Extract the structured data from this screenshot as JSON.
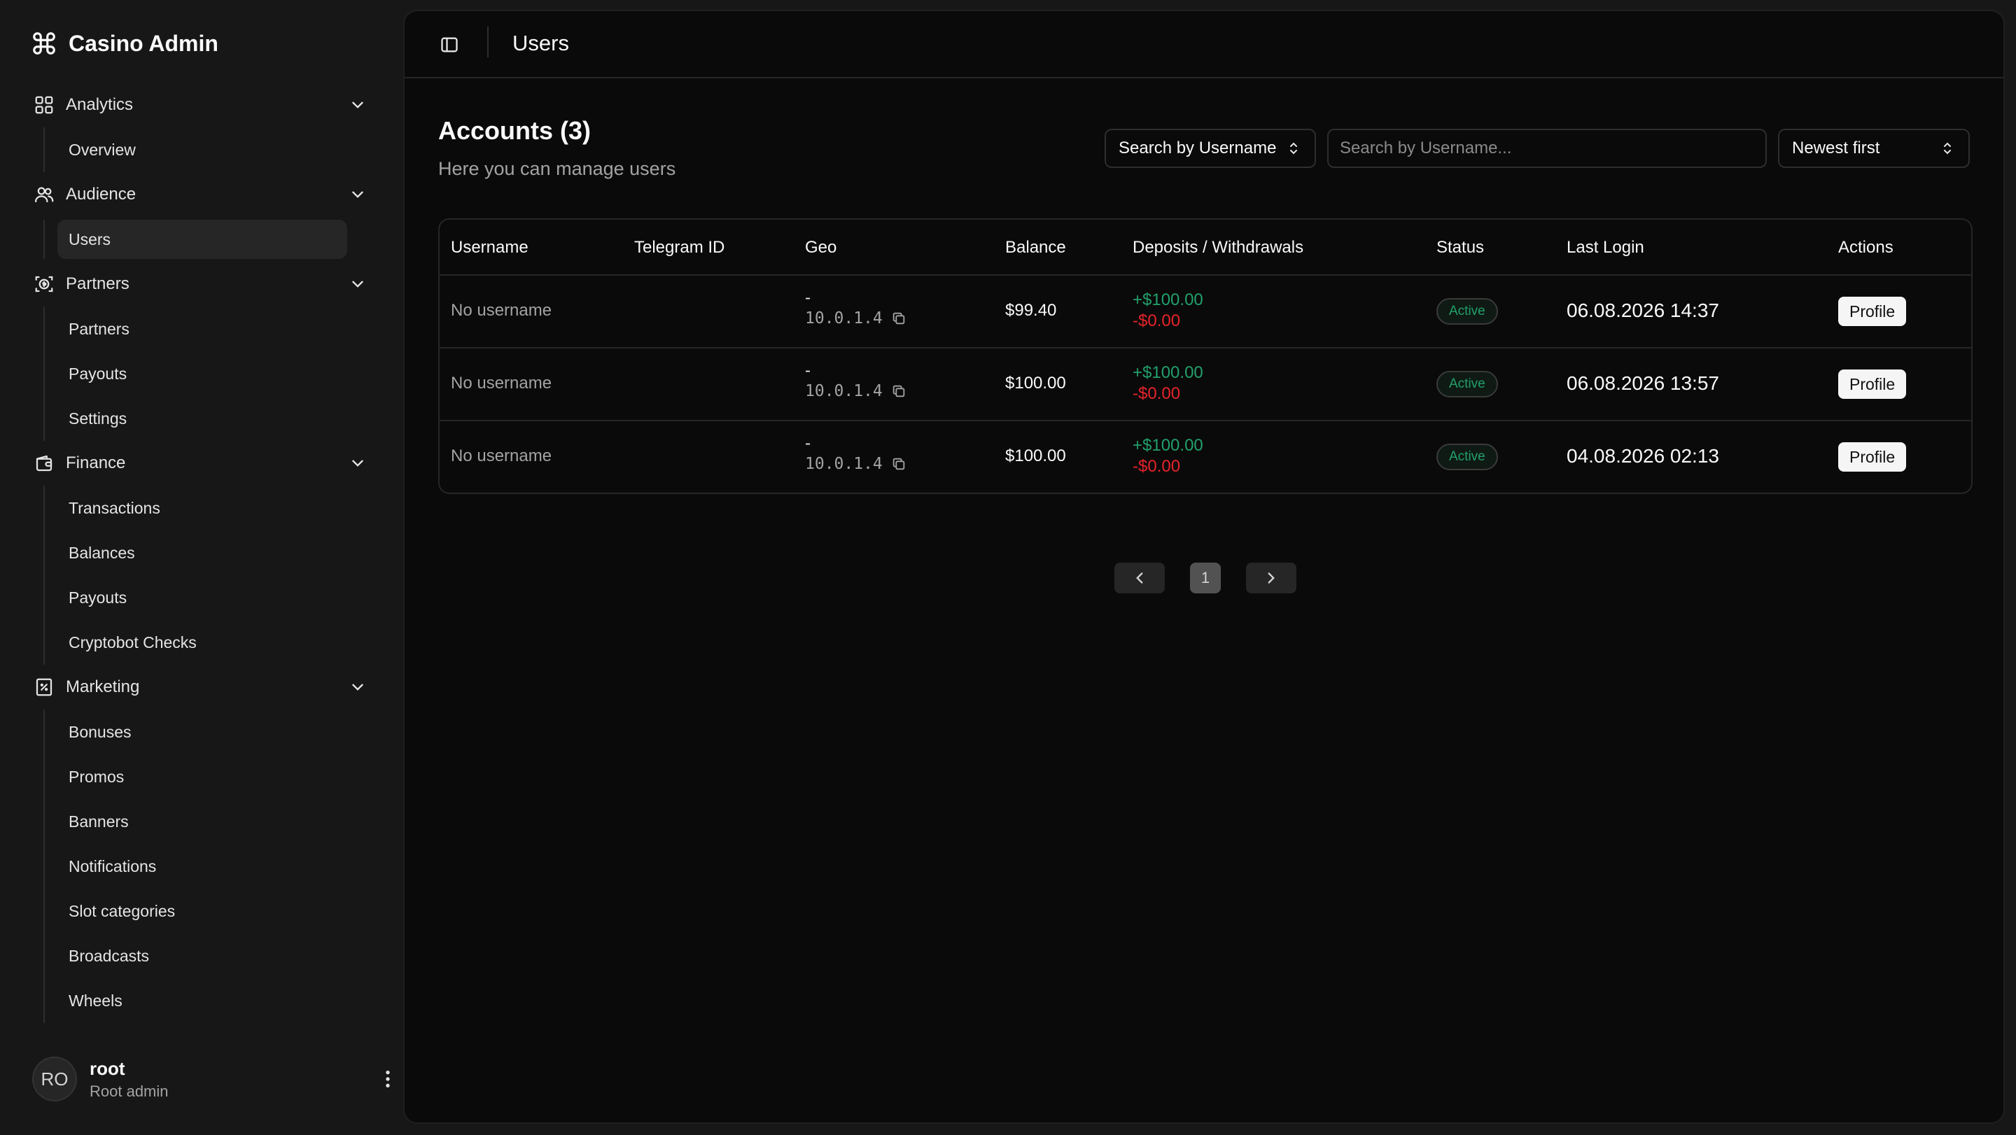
{
  "app": {
    "title": "Casino Admin"
  },
  "nav": {
    "groups": [
      {
        "label": "Analytics",
        "icon": "grid-icon",
        "items": [
          "Overview"
        ]
      },
      {
        "label": "Audience",
        "icon": "users-icon",
        "items": [
          "Users"
        ]
      },
      {
        "label": "Partners",
        "icon": "partners-icon",
        "items": [
          "Partners",
          "Payouts",
          "Settings"
        ]
      },
      {
        "label": "Finance",
        "icon": "wallet-icon",
        "items": [
          "Transactions",
          "Balances",
          "Payouts",
          "Cryptobot Checks"
        ]
      },
      {
        "label": "Marketing",
        "icon": "receipt-percent-icon",
        "items": [
          "Bonuses",
          "Promos",
          "Banners",
          "Notifications",
          "Slot categories",
          "Broadcasts",
          "Wheels"
        ]
      }
    ],
    "active_item": "Users"
  },
  "user": {
    "initials": "RO",
    "name": "root",
    "role": "Root admin"
  },
  "topbar": {
    "title": "Users"
  },
  "page": {
    "heading": "Accounts (3)",
    "subheading": "Here you can manage users"
  },
  "filters": {
    "search_field": "Search by Username",
    "search_placeholder": "Search by Username...",
    "search_value": "",
    "sort": "Newest first"
  },
  "table": {
    "columns": [
      "Username",
      "Telegram ID",
      "Geo",
      "Balance",
      "Deposits / Withdrawals",
      "Status",
      "Last Login",
      "Actions"
    ],
    "rows": [
      {
        "username": "No username",
        "telegram_id": "",
        "geo_country": "-",
        "geo_ip": "10.0.1.4",
        "balance": "$99.40",
        "deposits": "+$100.00",
        "withdrawals": "-$0.00",
        "status": "Active",
        "last_login": "06.08.2026 14:37",
        "action": "Profile"
      },
      {
        "username": "No username",
        "telegram_id": "",
        "geo_country": "-",
        "geo_ip": "10.0.1.4",
        "balance": "$100.00",
        "deposits": "+$100.00",
        "withdrawals": "-$0.00",
        "status": "Active",
        "last_login": "06.08.2026 13:57",
        "action": "Profile"
      },
      {
        "username": "No username",
        "telegram_id": "",
        "geo_country": "-",
        "geo_ip": "10.0.1.4",
        "balance": "$100.00",
        "deposits": "+$100.00",
        "withdrawals": "-$0.00",
        "status": "Active",
        "last_login": "04.08.2026 02:13",
        "action": "Profile"
      }
    ]
  },
  "pagination": {
    "current_page": "1"
  },
  "colors": {
    "background": "#0a0a0a",
    "sidebar": "#171717",
    "deposit": "#22a06b",
    "withdrawal": "#e5242b",
    "status_active": "#22a06b"
  }
}
